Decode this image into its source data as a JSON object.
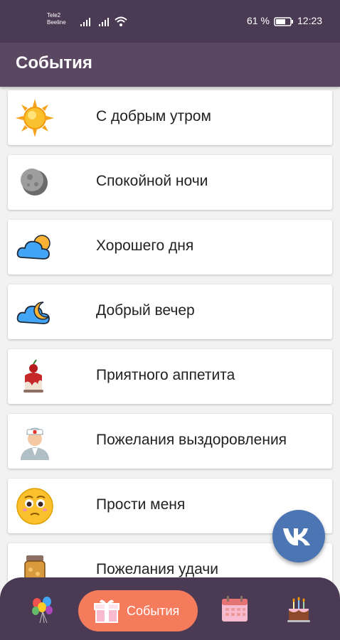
{
  "status_bar": {
    "carrier_1": "Tele2",
    "carrier_2": "Beeline",
    "battery": "61 %",
    "time": "12:23"
  },
  "app_bar": {
    "title": "События"
  },
  "events": [
    {
      "label": "С добрым утром",
      "icon": "sun-icon"
    },
    {
      "label": "Спокойной ночи",
      "icon": "moon-icon"
    },
    {
      "label": "Хорошего дня",
      "icon": "cloud-sun-icon"
    },
    {
      "label": "Добрый вечер",
      "icon": "cloud-moon-icon"
    },
    {
      "label": "Приятного аппетита",
      "icon": "dessert-icon"
    },
    {
      "label": "Пожелания выздоровления",
      "icon": "doctor-icon"
    },
    {
      "label": "Прости меня",
      "icon": "sorry-face-icon"
    },
    {
      "label": "Пожелания удачи",
      "icon": "jar-icon"
    }
  ],
  "fab": {
    "icon": "vk-logo-icon"
  },
  "bottom_nav": {
    "items": [
      {
        "icon": "balloons-icon"
      },
      {
        "icon": "gift-icon",
        "label": "События",
        "active": true
      },
      {
        "icon": "calendar-icon"
      },
      {
        "icon": "birthday-cake-icon"
      }
    ]
  },
  "colors": {
    "status_bar": "#4a3a53",
    "app_bar": "#5a4862",
    "active_tab": "#f47c5d",
    "vk_blue": "#4c75b3"
  }
}
